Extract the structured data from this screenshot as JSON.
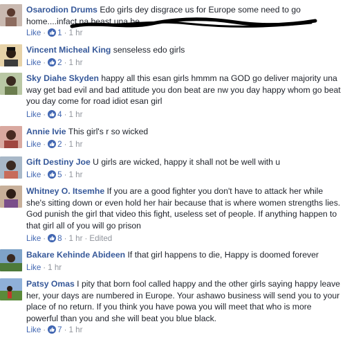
{
  "comments": [
    {
      "name": "Osarodion Drums",
      "text": "Edo girls dey disgrace us for Europe some need to go home....infact na beast una be",
      "like": "Like",
      "count": "1",
      "time": "1 hr"
    },
    {
      "name": "Vincent Micheal King",
      "text": "senseless edo girls",
      "like": "Like",
      "count": "2",
      "time": "1 hr"
    },
    {
      "name": "Sky Diahe Skyden",
      "text": "happy all this esan girls hmmm na GOD go deliver majority una way get bad evil and bad attitude you don beat are nw you day happy whom go beat you day come for road idiot esan girl",
      "like": "Like",
      "count": "4",
      "time": "1 hr"
    },
    {
      "name": "Annie Ivie",
      "text": "This girl's r so wicked",
      "like": "Like",
      "count": "2",
      "time": "1 hr"
    },
    {
      "name": "Gift Destiny Joe",
      "text": "U girls are wicked, happy it shall not be well with u",
      "like": "Like",
      "count": "5",
      "time": "1 hr"
    },
    {
      "name": "Whitney O. Itsemhe",
      "text": "If you are a good fighter you don't have to attack her while she's sitting down or even hold her hair because that is where women strengths lies. God punish the girl that video this fight, useless set of people. If anything happen to that girl all of you will go prison",
      "like": "Like",
      "count": "8",
      "time": "1 hr",
      "edited": "Edited"
    },
    {
      "name": "Bakare Kehinde Abideen",
      "text": "If that girl happens to die, Happy is doomed forever",
      "like": "Like",
      "time": "1 hr"
    },
    {
      "name": "Patsy Omas",
      "text": "I pity that born fool called happy and the other girls saying happy leave her, your days are numbered in Europe. Your ashawo business will send you to your place of no return. If you think you have powa you will meet that who is more powerful than you and she will beat you blue black.",
      "like": "Like",
      "count": "7",
      "time": "1 hr"
    }
  ],
  "colors": {
    "name": "#365899",
    "like": "#4267b2",
    "meta": "#90949c",
    "text": "#1d2129"
  }
}
